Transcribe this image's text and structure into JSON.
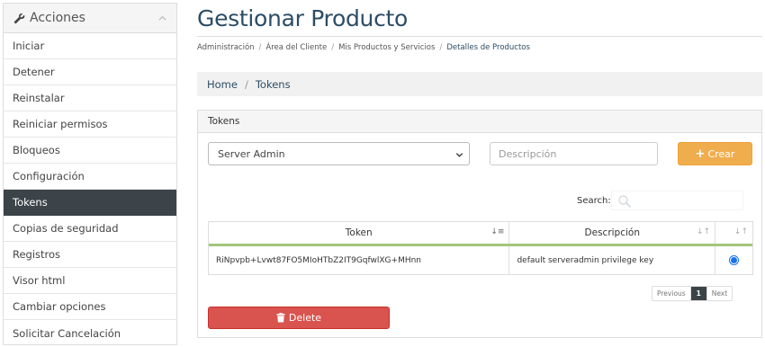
{
  "sidebar": {
    "title": "Acciones",
    "items": [
      {
        "label": "Iniciar"
      },
      {
        "label": "Detener"
      },
      {
        "label": "Reinstalar"
      },
      {
        "label": "Reiniciar permisos"
      },
      {
        "label": "Bloqueos"
      },
      {
        "label": "Configuración"
      },
      {
        "label": "Tokens",
        "active": true
      },
      {
        "label": "Copias de seguridad"
      },
      {
        "label": "Registros"
      },
      {
        "label": "Visor html"
      },
      {
        "label": "Cambiar opciones"
      },
      {
        "label": "Solicitar Cancelación"
      }
    ]
  },
  "page": {
    "title": "Gestionar Producto",
    "breadcrumb": [
      "Administración",
      "Área del Cliente",
      "Mis Productos y Servicios",
      "Detalles de Productos"
    ]
  },
  "crumb_bar": {
    "home": "Home",
    "current": "Tokens"
  },
  "panel": {
    "heading": "Tokens",
    "select_value": "Server Admin",
    "description_placeholder": "Descripción",
    "create_label": "Crear",
    "search_label": "Search:",
    "table": {
      "headers": [
        "Token",
        "Descripción"
      ],
      "rows": [
        {
          "token": "RiNpvpb+Lvwt87FO5MIoHTbZ2IT9GqfwlXG+MHnn",
          "description": "default serveradmin privilege key",
          "selected": true
        }
      ]
    },
    "pagination": {
      "previous": "Previous",
      "current": "1",
      "next": "Next"
    },
    "delete_label": "Delete"
  },
  "colors": {
    "title": "#2c4d66",
    "active_item_bg": "#3c4449",
    "create_button": "#f0ad4e",
    "delete_button": "#d9534f",
    "table_header_rule": "#a3c77a"
  }
}
